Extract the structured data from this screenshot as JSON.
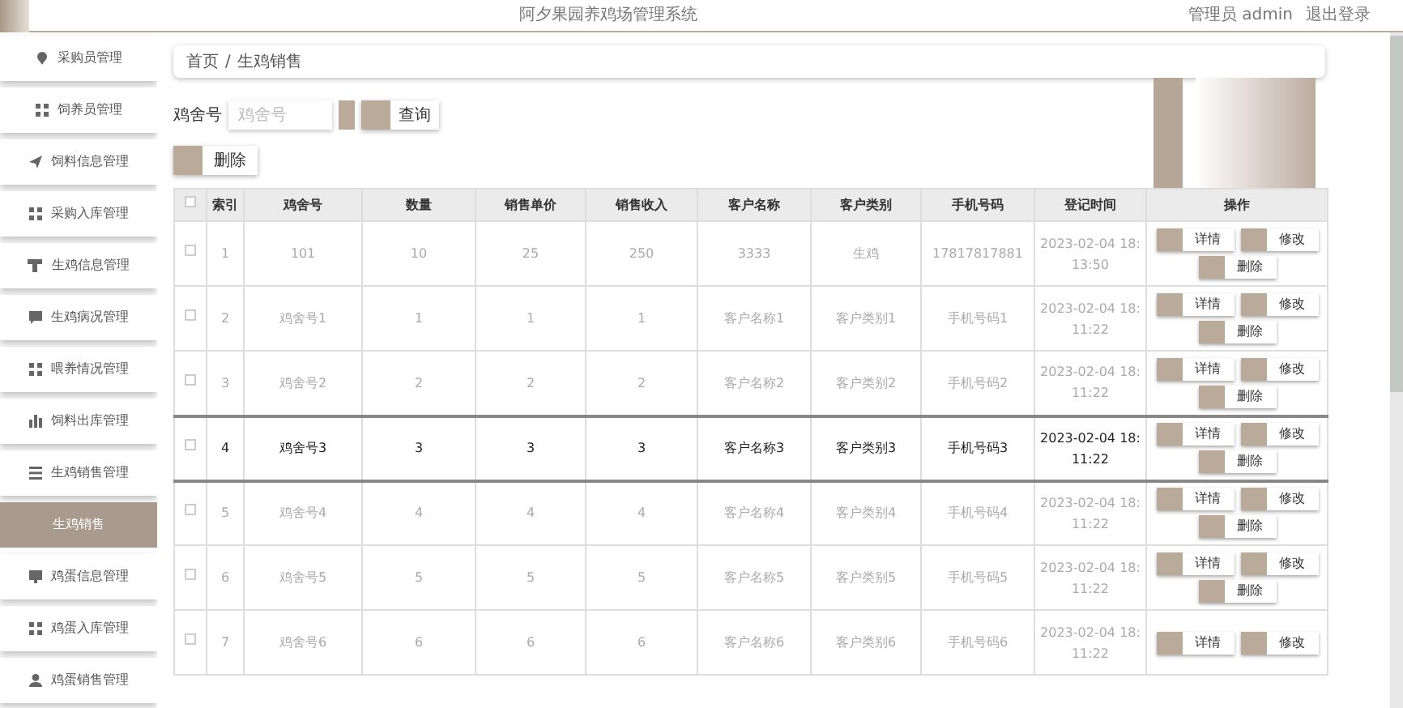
{
  "header": {
    "title": "阿夕果园养鸡场管理系统",
    "user": "管理员 admin",
    "logout": "退出登录"
  },
  "sidebar": {
    "items": [
      {
        "label": "采购员管理",
        "selected": false
      },
      {
        "label": "饲养员管理",
        "selected": false
      },
      {
        "label": "饲料信息管理",
        "selected": false
      },
      {
        "label": "采购入库管理",
        "selected": false
      },
      {
        "label": "生鸡信息管理",
        "selected": false
      },
      {
        "label": "生鸡病况管理",
        "selected": false
      },
      {
        "label": "喂养情况管理",
        "selected": false
      },
      {
        "label": "饲料出库管理",
        "selected": false
      },
      {
        "label": "生鸡销售管理",
        "selected": false
      },
      {
        "label": "生鸡销售",
        "selected": true
      },
      {
        "label": "鸡蛋信息管理",
        "selected": false
      },
      {
        "label": "鸡蛋入库管理",
        "selected": false
      },
      {
        "label": "鸡蛋销售管理",
        "selected": false
      }
    ]
  },
  "breadcrumb": [
    "首页",
    "/",
    "生鸡销售"
  ],
  "search": {
    "label": "鸡舍号",
    "placeholder": "鸡舍号",
    "button": "查询"
  },
  "delete_button": "删除",
  "table": {
    "select_all_checked": false,
    "columns": [
      "索引",
      "鸡舍号",
      "数量",
      "销售单价",
      "销售收入",
      "客户名称",
      "客户类别",
      "手机号码",
      "登记时间",
      "操作"
    ],
    "rows": [
      {
        "checked": false,
        "highlighted": false,
        "cells": [
          "1",
          "101",
          "10",
          "25",
          "250",
          "3333",
          "生鸡",
          "17817817881",
          "2023-02-04 18:13:50"
        ],
        "actions": [
          "详情",
          "修改",
          "删除"
        ]
      },
      {
        "checked": false,
        "highlighted": false,
        "cells": [
          "2",
          "鸡舍号1",
          "1",
          "1",
          "1",
          "客户名称1",
          "客户类别1",
          "手机号码1",
          "2023-02-04 18:11:22"
        ],
        "actions": [
          "详情",
          "修改",
          "删除"
        ]
      },
      {
        "checked": false,
        "highlighted": false,
        "cells": [
          "3",
          "鸡舍号2",
          "2",
          "2",
          "2",
          "客户名称2",
          "客户类别2",
          "手机号码2",
          "2023-02-04 18:11:22"
        ],
        "actions": [
          "详情",
          "修改",
          "删除"
        ]
      },
      {
        "checked": false,
        "highlighted": true,
        "cells": [
          "4",
          "鸡舍号3",
          "3",
          "3",
          "3",
          "客户名称3",
          "客户类别3",
          "手机号码3",
          "2023-02-04 18:11:22"
        ],
        "actions": [
          "详情",
          "修改",
          "删除"
        ]
      },
      {
        "checked": false,
        "highlighted": false,
        "cells": [
          "5",
          "鸡舍号4",
          "4",
          "4",
          "4",
          "客户名称4",
          "客户类别4",
          "手机号码4",
          "2023-02-04 18:11:22"
        ],
        "actions": [
          "详情",
          "修改",
          "删除"
        ]
      },
      {
        "checked": false,
        "highlighted": false,
        "cells": [
          "6",
          "鸡舍号5",
          "5",
          "5",
          "5",
          "客户名称5",
          "客户类别5",
          "手机号码5",
          "2023-02-04 18:11:22"
        ],
        "actions": [
          "详情",
          "修改",
          "删除"
        ]
      },
      {
        "checked": false,
        "highlighted": false,
        "cells": [
          "7",
          "鸡舍号6",
          "6",
          "6",
          "6",
          "客户名称6",
          "客户类别6",
          "手机号码6",
          "2023-02-04 18:11:22"
        ],
        "actions": [
          "详情",
          "修改"
        ]
      }
    ]
  }
}
